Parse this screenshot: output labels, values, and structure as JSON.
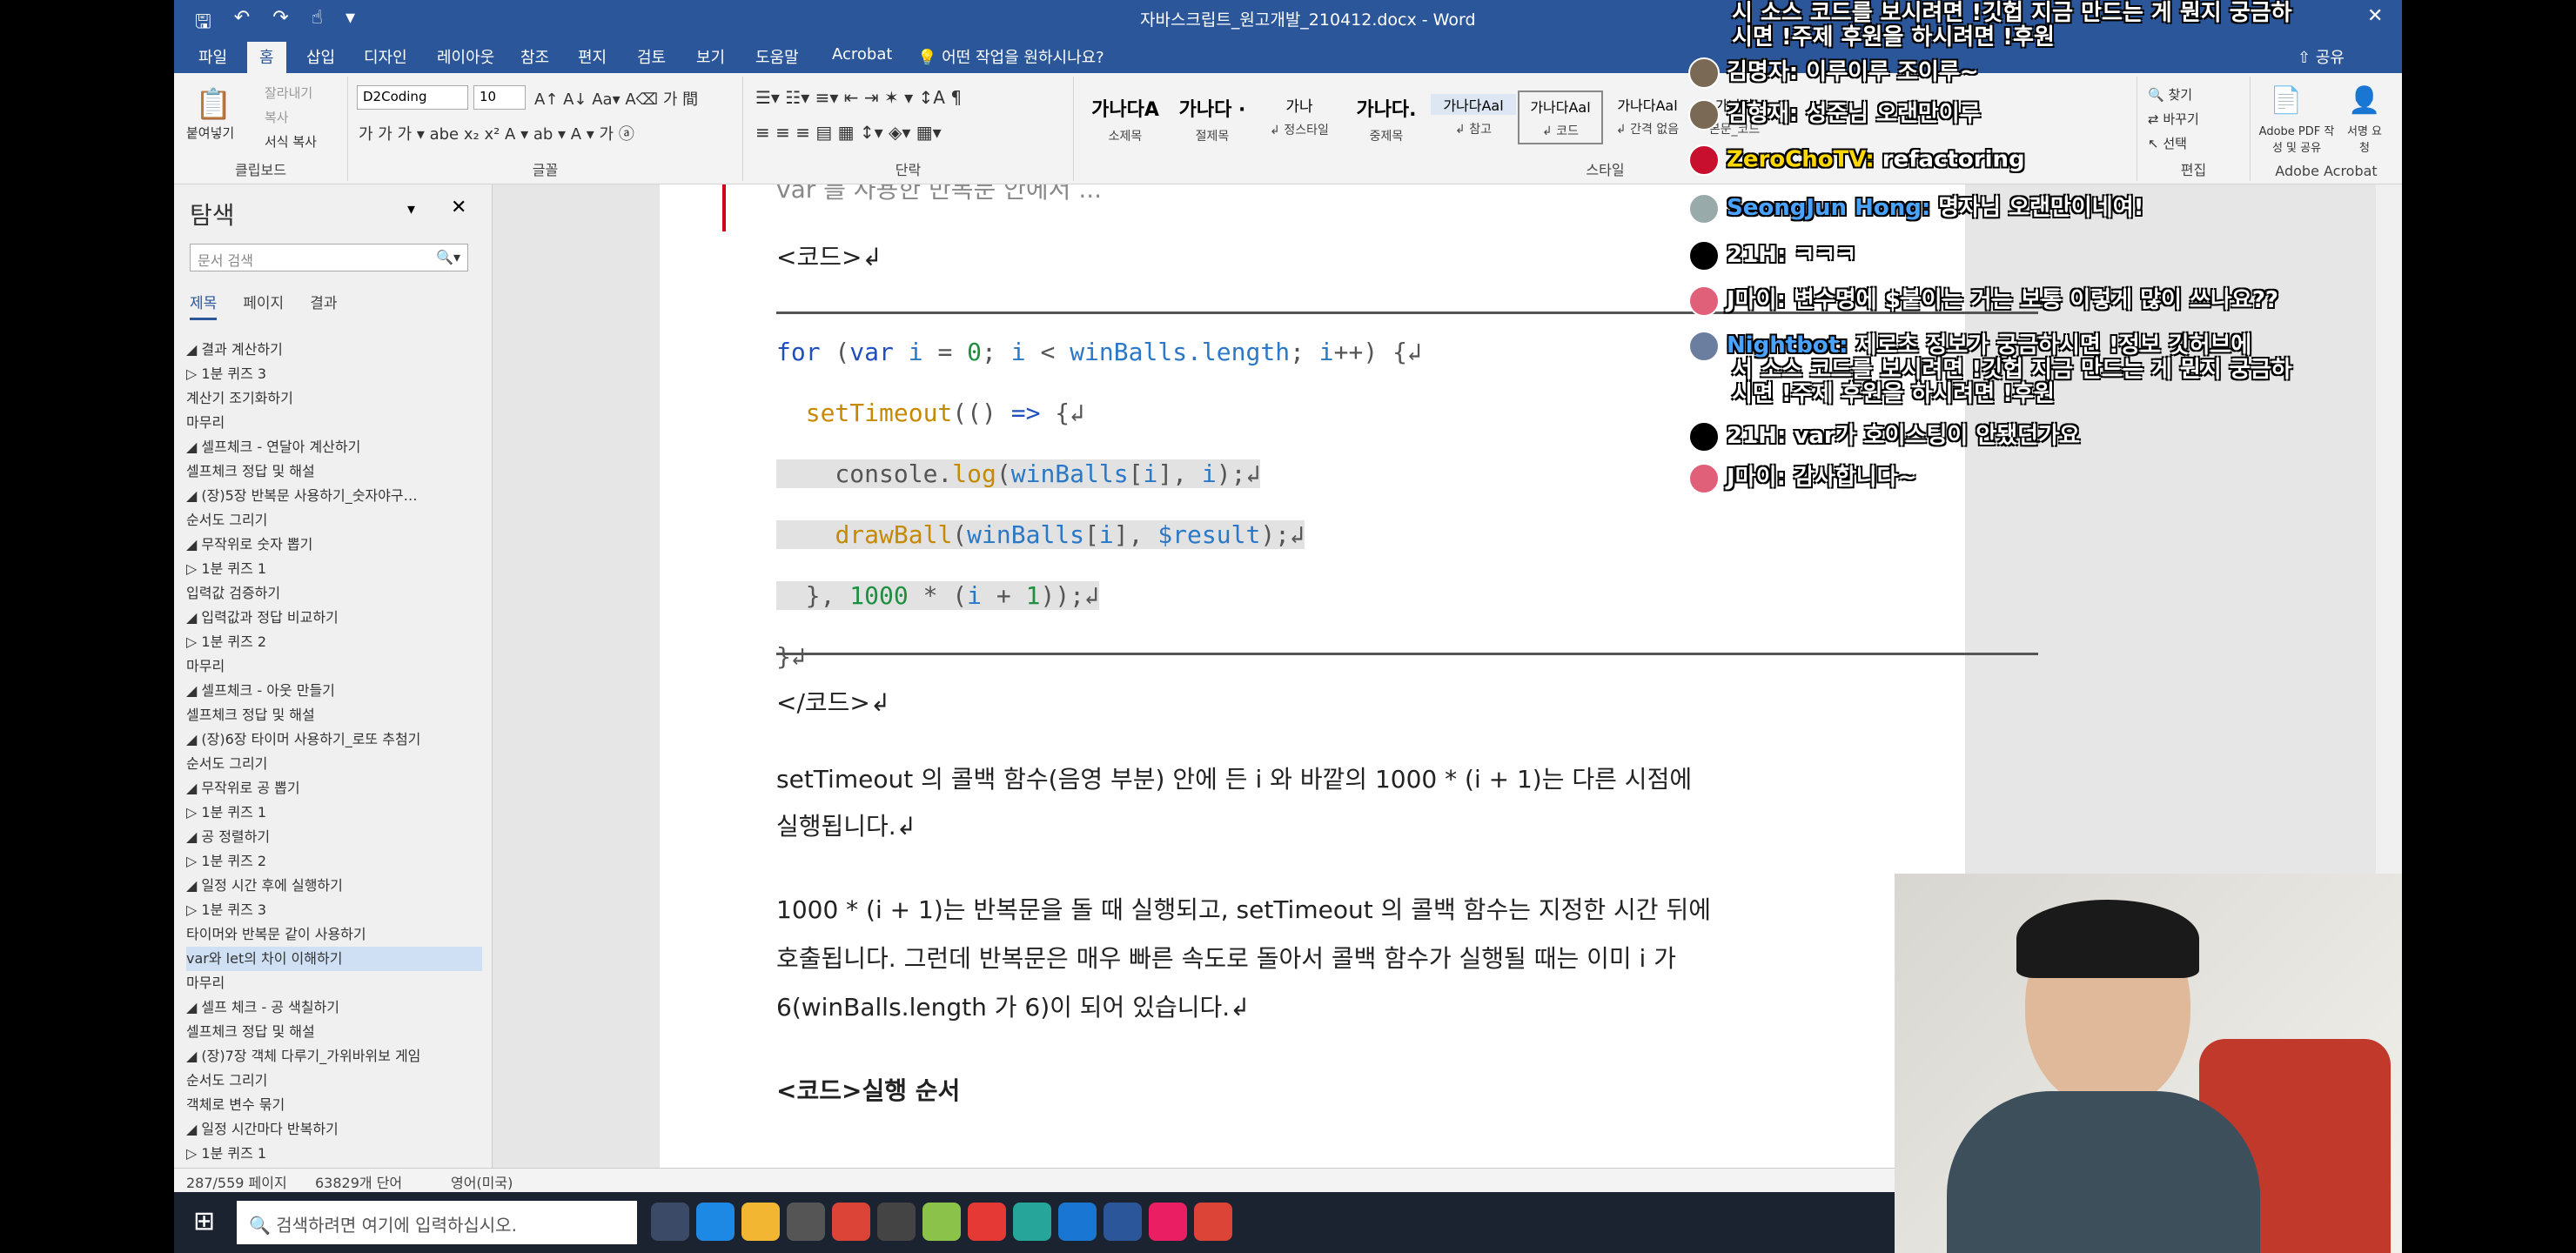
{
  "window": {
    "title": "자바스크립트_원고개발_210412.docx  -  Word"
  },
  "ribbon_tabs": [
    "파일",
    "홈",
    "삽입",
    "디자인",
    "레이아웃",
    "참조",
    "편지",
    "검토",
    "보기",
    "도움말",
    "Acrobat",
    "어떤 작업을 원하시나요?"
  ],
  "active_tab": "홈",
  "clipboard": {
    "paste": "붙여넣기",
    "cut": "잘라내기",
    "copy": "복사",
    "format_painter": "서식 복사",
    "label": "클립보드"
  },
  "font": {
    "name": "D2Coding",
    "size": "10",
    "label": "글꼴"
  },
  "paragraph": {
    "label": "단락"
  },
  "styles": {
    "label": "스타일",
    "items": [
      {
        "preview": "가나다A",
        "name": "소제목"
      },
      {
        "preview": "가나다 ·",
        "name": "절제목"
      },
      {
        "preview": "가나",
        "name": "↲ 정스타일"
      },
      {
        "preview": "가나다.",
        "name": "중제목"
      },
      {
        "preview": "가나다Aal",
        "name": "↲ 참고"
      },
      {
        "preview": "가나다Aal",
        "name": "↲ 코드"
      },
      {
        "preview": "가나다Aal",
        "name": "↲ 간격 없음"
      },
      {
        "preview": "가나다",
        "name": "본문_코드"
      }
    ]
  },
  "editing": {
    "find": "찾기",
    "replace": "바꾸기",
    "select": "선택",
    "label": "편집"
  },
  "acrobat": {
    "create": "Adobe PDF 작성 및 공유",
    "sign": "서명 요청",
    "label": "Adobe Acrobat"
  },
  "share": "공유",
  "navigation": {
    "title": "탐색",
    "search_placeholder": "문서 검색",
    "tabs": [
      "제목",
      "페이지",
      "결과"
    ],
    "items": [
      "◢ 결과 계산하기",
      "   ▷ 1분 퀴즈 3",
      "   계산기 조기화하기",
      "   마무리",
      "◢ 셀프체크 - 연달아 계산하기",
      "       셀프체크 정답 및 해설",
      "◢ (장)5장 반복문 사용하기_숫자야구…",
      "   순서도 그리기",
      "◢ 무작위로 숫자 뽑기",
      "   ▷ 1분 퀴즈 1",
      "   입력값 검증하기",
      "◢ 입력값과 정답 비교하기",
      "   ▷ 1분 퀴즈 2",
      "   마무리",
      "◢ 셀프체크 - 아웃 만들기",
      "       셀프체크 정답 및 해설",
      "◢ (장)6장  타이머 사용하기_로또 추첨기",
      "   순서도 그리기",
      "◢ 무작위로 공 뽑기",
      "   ▷ 1분 퀴즈 1",
      "◢ 공 정렬하기",
      "   ▷ 1분 퀴즈 2",
      "◢ 일정 시간 후에 실행하기",
      "   ▷ 1분 퀴즈 3",
      "   타이머와 반복문 같이 사용하기",
      "   var와 let의 차이 이해하기",
      "   마무리",
      "◢ 셀프 체크 - 공 색칠하기",
      "       셀프체크 정답 및 해설",
      "◢ (장)7장  객체 다루기_가위바위보 게임",
      "   순서도 그리기",
      "   객체로 변수 묶기",
      "◢ 일정 시간마다 반복하기",
      "   ▷ 1분 퀴즈 1"
    ],
    "selected_index": 25
  },
  "document": {
    "top_partial": "var 를 사용한 반복문 안에서 ...",
    "code_open": "<코드>↲",
    "code_lines": [
      {
        "segments": [
          [
            "kw",
            "for"
          ],
          [
            "gr",
            " ("
          ],
          [
            "kw",
            "var"
          ],
          [
            "gr",
            " "
          ],
          [
            "id",
            "i"
          ],
          [
            "gr",
            " = "
          ],
          [
            "num",
            "0"
          ],
          [
            "gr",
            "; "
          ],
          [
            "id",
            "i"
          ],
          [
            "gr",
            " < "
          ],
          [
            "id",
            "winBalls.length"
          ],
          [
            "gr",
            "; "
          ],
          [
            "id",
            "i"
          ],
          [
            "gr",
            "++) {↲"
          ]
        ]
      },
      {
        "segments": [
          [
            "gr",
            "  "
          ],
          [
            "fn",
            "setTimeout"
          ],
          [
            "gr",
            "(() "
          ],
          [
            "kw",
            "=>"
          ],
          [
            "gr",
            " {↲"
          ]
        ]
      },
      {
        "segments": [
          [
            "gr",
            "    console."
          ],
          [
            "fn",
            "log"
          ],
          [
            "gr",
            "("
          ],
          [
            "id",
            "winBalls"
          ],
          [
            "gr",
            "["
          ],
          [
            "id",
            "i"
          ],
          [
            "gr",
            "], "
          ],
          [
            "id",
            "i"
          ],
          [
            "gr",
            ");↲"
          ]
        ]
      },
      {
        "segments": [
          [
            "gr",
            "    "
          ],
          [
            "fn",
            "drawBall"
          ],
          [
            "gr",
            "("
          ],
          [
            "id",
            "winBalls"
          ],
          [
            "gr",
            "["
          ],
          [
            "id",
            "i"
          ],
          [
            "gr",
            "], "
          ],
          [
            "id",
            "$result"
          ],
          [
            "gr",
            ");↲"
          ]
        ]
      },
      {
        "segments": [
          [
            "gr",
            "  }, "
          ],
          [
            "num",
            "1000"
          ],
          [
            "gr",
            " * ("
          ],
          [
            "id",
            "i"
          ],
          [
            "gr",
            " + "
          ],
          [
            "num",
            "1"
          ],
          [
            "gr",
            "));↲"
          ]
        ]
      },
      {
        "segments": [
          [
            "gr",
            "}↲"
          ]
        ]
      }
    ],
    "code_close": "</코드>↲",
    "para1_line1": "setTimeout 의 콜백 함수(음영 부분) 안에 든 i 와 바깥의 1000 * (i + 1)는 다른 시점에",
    "para1_line2": "실행됩니다.↲",
    "para2_line1": "1000 * (i + 1)는 반복문을 돌 때 실행되고, setTimeout 의 콜백 함수는 지정한 시간 뒤에",
    "para2_line2": "호출됩니다. 그런데 반복문은 매우 빠른 속도로 돌아서 콜백 함수가 실행될 때는 이미 i 가",
    "para2_line3": "6(winBalls.length 가 6)이 되어 있습니다.↲",
    "heading": "<코드>실행 순서"
  },
  "status": {
    "page": "287/559 페이지",
    "words": "63829개 단어",
    "lang": "영어(미국)"
  },
  "taskbar": {
    "search_placeholder": "검색하려면 여기에 입력하십시오."
  },
  "chat": {
    "messages": [
      {
        "name": "",
        "text": "시 소스 코드를 보시려면 !깃헙 지금 만드는 게 뭔지 궁금하",
        "color": "#ffffff",
        "avatar": ""
      },
      {
        "name": "",
        "text": "시면 !주제 후원을 하시려면 !후원",
        "color": "#ffffff",
        "avatar": ""
      },
      {
        "name": "김명자:",
        "text": "이루이루 조이루~",
        "color": "#ffffff",
        "avatar": "#7a6a55"
      },
      {
        "name": "김형재:",
        "text": "성준님 오랜만이루",
        "color": "#ffffff",
        "avatar": "#7a6a55"
      },
      {
        "name": "ZeroChoTV:",
        "text": "refactoring",
        "color": "#ffd800",
        "avatar": "#c8102e"
      },
      {
        "name": "SeongJun Hong:",
        "text": "명자님 오랜만이네여!",
        "color": "#4aa3ff",
        "avatar": "#9aa"
      },
      {
        "name": "21H:",
        "text": "ㅋㅋㅋ",
        "color": "#ffffff",
        "avatar": "#000000"
      },
      {
        "name": "J마이:",
        "text": "변수명에 $붙이는 거는 보통 이렇게 많이 쓰나요??",
        "color": "#ffffff",
        "avatar": "#e0607a"
      },
      {
        "name": "Nightbot:",
        "text": "제로초 정보가 궁금하시면 !정보 깃허브에",
        "color": "#4aa3ff",
        "avatar": "#6b7ea0"
      },
      {
        "name": "",
        "text": "서 소스 코드를 보시려면 !깃헙 지금 만드는 게 뭔지 궁금하",
        "color": "#ffffff",
        "avatar": ""
      },
      {
        "name": "",
        "text": "시면 !주제 후원을 하시려면 !후원",
        "color": "#ffffff",
        "avatar": ""
      },
      {
        "name": "21H:",
        "text": "var가 호이스팅이 안됐던가요",
        "color": "#ffffff",
        "avatar": "#000000"
      },
      {
        "name": "J마이:",
        "text": "감사합니다~",
        "color": "#ffffff",
        "avatar": "#e0607a"
      }
    ]
  },
  "colors": {
    "word_blue": "#2b579a",
    "keyword": "#1f4fbf",
    "ident": "#2a78c7",
    "func": "#c58a00",
    "number": "#1e8f3e"
  }
}
